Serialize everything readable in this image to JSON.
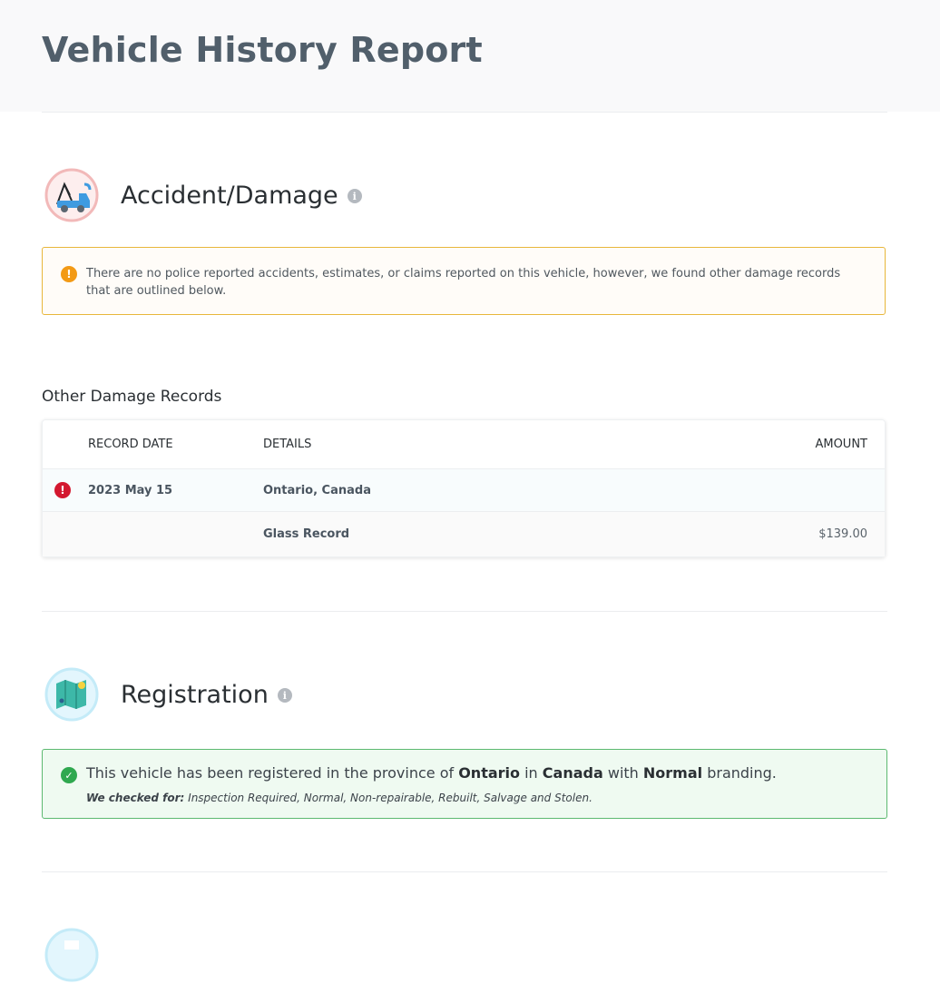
{
  "page": {
    "title": "Vehicle History Report"
  },
  "accident": {
    "title": "Accident/Damage",
    "info_icon": "i",
    "alert_text": "There are no police reported accidents, estimates, or claims reported on this vehicle, however, we found other damage records that are outlined below.",
    "alert_icon": "!"
  },
  "damage_records": {
    "title": "Other Damage Records",
    "columns": {
      "date": "RECORD DATE",
      "details": "DETAILS",
      "amount": "AMOUNT"
    },
    "rows": [
      {
        "date": "2023 May 15",
        "details": "Ontario, Canada",
        "amount": ""
      },
      {
        "date": "",
        "details": "Glass Record",
        "amount": "$139.00"
      }
    ],
    "row_icon": "!"
  },
  "registration": {
    "title": "Registration",
    "info_icon": "i",
    "check_icon": "✓",
    "text_pre": "This vehicle has been registered in the province of ",
    "province": "Ontario",
    "text_mid": " in ",
    "country": "Canada",
    "text_mid2": " with ",
    "branding": "Normal",
    "text_post": " branding.",
    "checked_label": "We checked for:",
    "checked_list": " Inspection Required, Normal, Non-repairable, Rebuilt, Salvage and Stolen."
  },
  "colors": {
    "warning": "#f39a15",
    "error": "#d3182f",
    "success": "#2fa84f"
  }
}
